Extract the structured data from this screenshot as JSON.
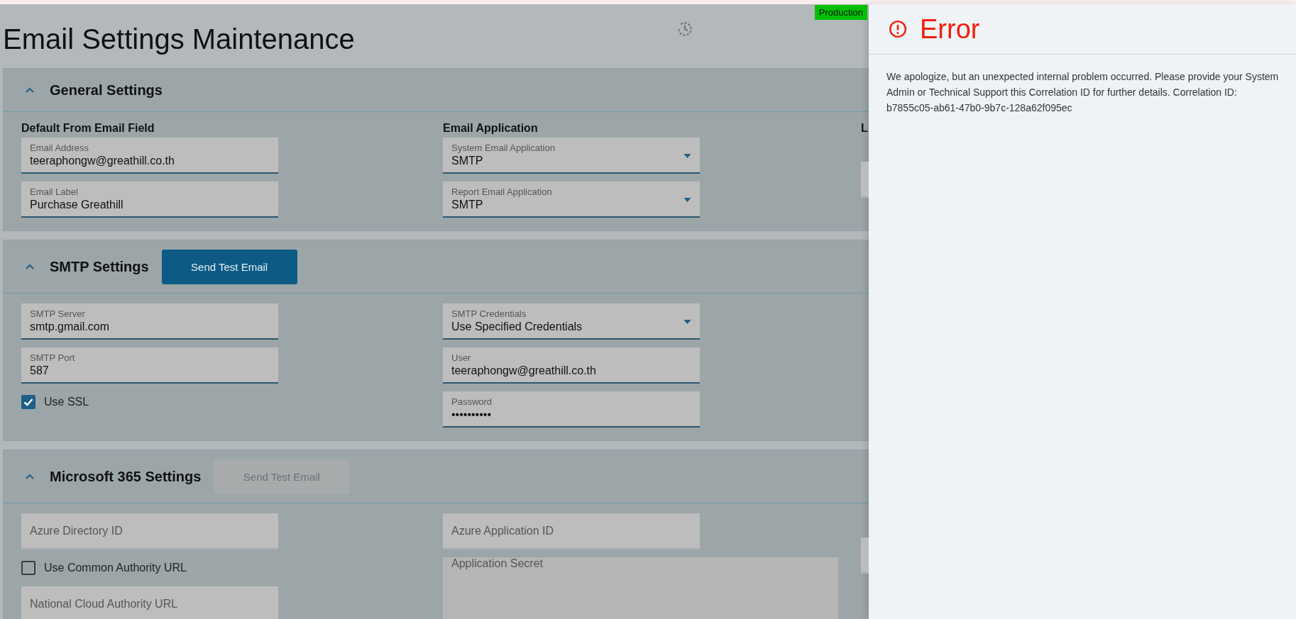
{
  "page_title": "Email Settings Maintenance",
  "environment_badge": "Production",
  "sections": [
    {
      "title": "General Settings",
      "expanded": true,
      "columns": [
        {
          "heading": "Default From Email Field",
          "items": [
            {
              "kind": "field",
              "label": "Email Address",
              "value": "teeraphongw@greathill.co.th"
            },
            {
              "kind": "field",
              "label": "Email Label",
              "value": "Purchase Greathill"
            }
          ]
        },
        {
          "heading": "Email Application",
          "items": [
            {
              "kind": "select",
              "label": "System Email Application",
              "value": "SMTP"
            },
            {
              "kind": "select",
              "label": "Report Email Application",
              "value": "SMTP"
            }
          ]
        },
        {
          "heading": "L",
          "items": [
            {
              "kind": "field"
            }
          ]
        }
      ]
    },
    {
      "title": "SMTP Settings",
      "expanded": true,
      "test_button": {
        "label": "Send Test Email",
        "disabled": false
      },
      "columns": [
        {
          "items": [
            {
              "kind": "field",
              "label": "SMTP Server",
              "value": "smtp.gmail.com"
            },
            {
              "kind": "field",
              "label": "SMTP Port",
              "value": "587"
            },
            {
              "kind": "checkbox",
              "label": "Use SSL",
              "checked": true
            }
          ]
        },
        {
          "items": [
            {
              "kind": "select",
              "label": "SMTP Credentials",
              "value": "Use Specified Credentials"
            },
            {
              "kind": "field",
              "label": "User",
              "value": "teeraphongw@greathill.co.th"
            },
            {
              "kind": "field",
              "label": "Password",
              "value": "••••••••••"
            }
          ]
        }
      ]
    },
    {
      "title": "Microsoft 365 Settings",
      "expanded": true,
      "test_button": {
        "label": "Send Test Email",
        "disabled": true
      },
      "columns": [
        {
          "items": [
            {
              "kind": "field",
              "label": "Azure Directory ID"
            },
            {
              "kind": "checkbox",
              "label": "Use Common Authority URL",
              "checked": false
            },
            {
              "kind": "field",
              "label": "National Cloud Authority URL"
            }
          ]
        },
        {
          "items": [
            {
              "kind": "field",
              "label": "Azure Application ID"
            },
            {
              "kind": "textarea",
              "label": "Application Secret"
            }
          ]
        },
        {
          "items": [
            {
              "kind": "field"
            }
          ]
        }
      ]
    }
  ],
  "error_panel": {
    "title": "Error",
    "message": "We apologize, but an unexpected internal problem occurred. Please provide your System Admin or Technical Support this Correlation ID for further details. Correlation ID: b7855c05-ab61-47b0-9b7c-128a62f095ec"
  }
}
